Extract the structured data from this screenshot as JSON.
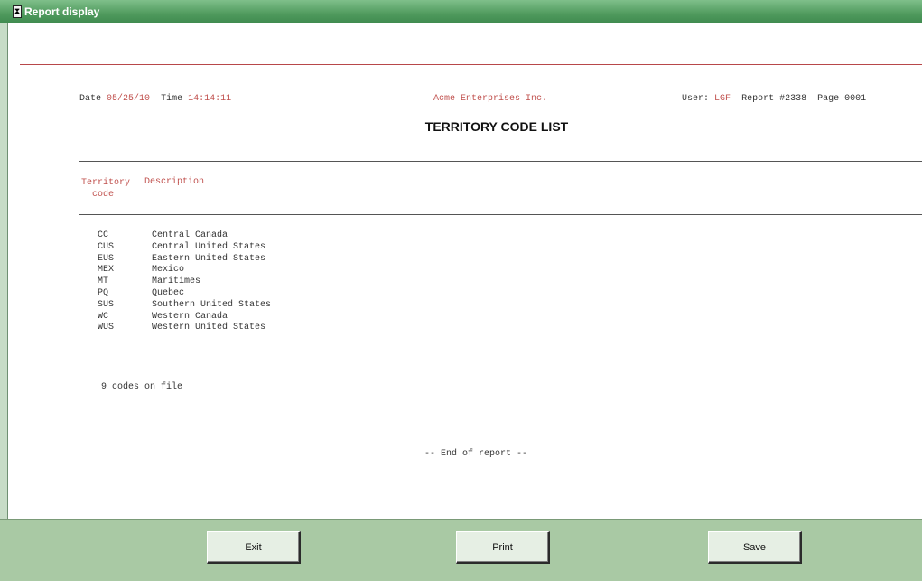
{
  "window": {
    "title": "Report display",
    "icon": "app-icon"
  },
  "report": {
    "header": {
      "date_label": "Date",
      "date_value": "05/25/10",
      "time_label": "Time",
      "time_value": "14:14:11",
      "company": "Acme Enterprises Inc.",
      "user_label": "User:",
      "user_value": "LGF",
      "report_label": "Report #2338",
      "page_label": "Page 0001"
    },
    "title": "TERRITORY CODE LIST",
    "columns": {
      "code_line1": "Territory",
      "code_line2": "code",
      "description": "Description"
    },
    "rows": [
      {
        "code": "CC",
        "description": "Central Canada"
      },
      {
        "code": "CUS",
        "description": "Central United States"
      },
      {
        "code": "EUS",
        "description": "Eastern United States"
      },
      {
        "code": "MEX",
        "description": "Mexico"
      },
      {
        "code": "MT",
        "description": "Maritimes"
      },
      {
        "code": "PQ",
        "description": "Quebec"
      },
      {
        "code": "SUS",
        "description": "Southern United States"
      },
      {
        "code": "WC",
        "description": "Western Canada"
      },
      {
        "code": "WUS",
        "description": "Western United States"
      }
    ],
    "summary": "9 codes on file",
    "end": "-- End of report --"
  },
  "buttons": {
    "exit": "Exit",
    "print": "Print",
    "save": "Save"
  },
  "colors": {
    "titlebar": "#4f9a5d",
    "button_bar": "#a9c9a4",
    "report_red": "#c0504d",
    "rule_red": "#b8484a"
  }
}
